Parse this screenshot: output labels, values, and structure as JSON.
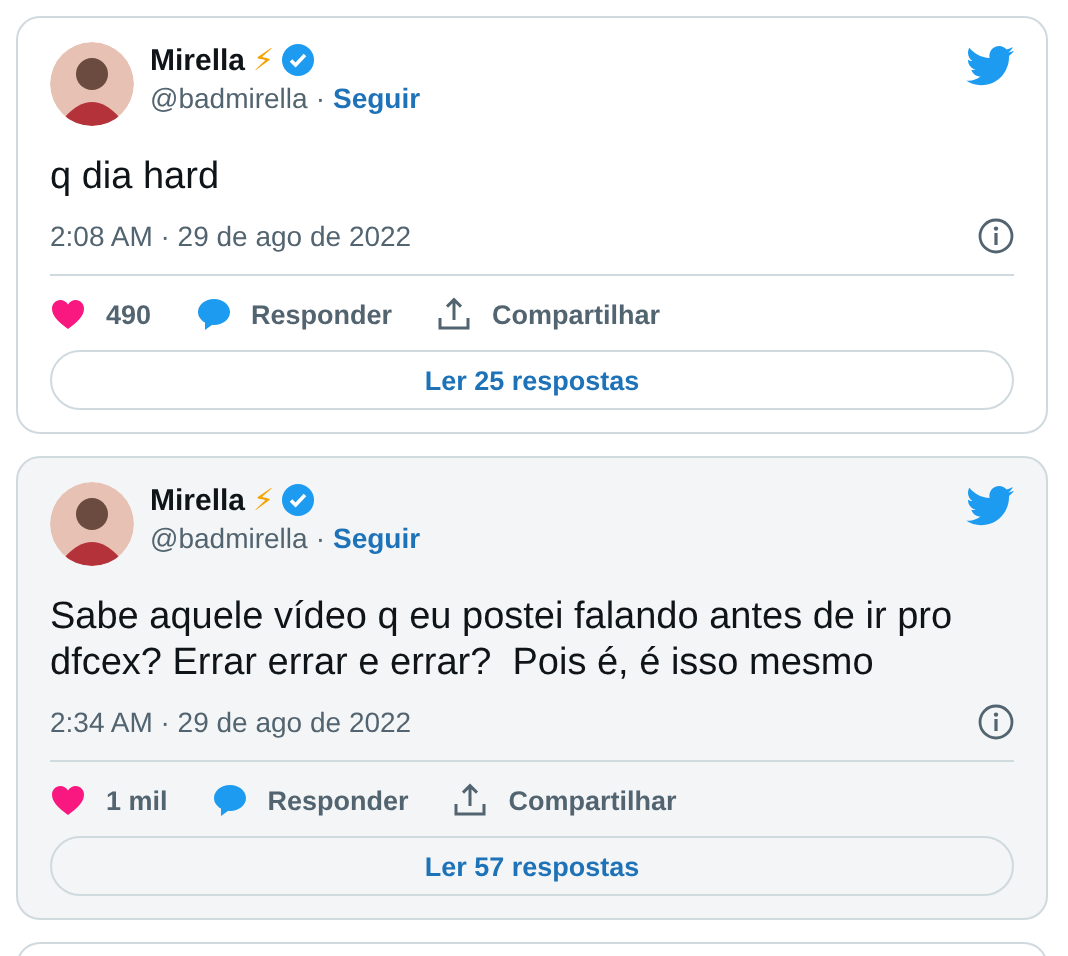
{
  "tweets": [
    {
      "highlighted": false,
      "name": "Mirella",
      "name_emoji": "⚡",
      "verified": true,
      "handle": "@badmirella",
      "separator": "·",
      "follow": "Seguir",
      "text": "q dia hard",
      "time": "2:08 AM · 29 de ago de 2022",
      "likes": "490",
      "reply": "Responder",
      "share": "Compartilhar",
      "read_replies": "Ler 25 respostas"
    },
    {
      "highlighted": true,
      "name": "Mirella",
      "name_emoji": "⚡",
      "verified": true,
      "handle": "@badmirella",
      "separator": "·",
      "follow": "Seguir",
      "text": "Sabe aquele vídeo q eu postei falando antes de ir pro dfcex? Errar errar e errar?  Pois é, é isso mesmo",
      "time": "2:34 AM · 29 de ago de 2022",
      "likes": "1 mil",
      "reply": "Responder",
      "share": "Compartilhar",
      "read_replies": "Ler 57 respostas"
    }
  ]
}
